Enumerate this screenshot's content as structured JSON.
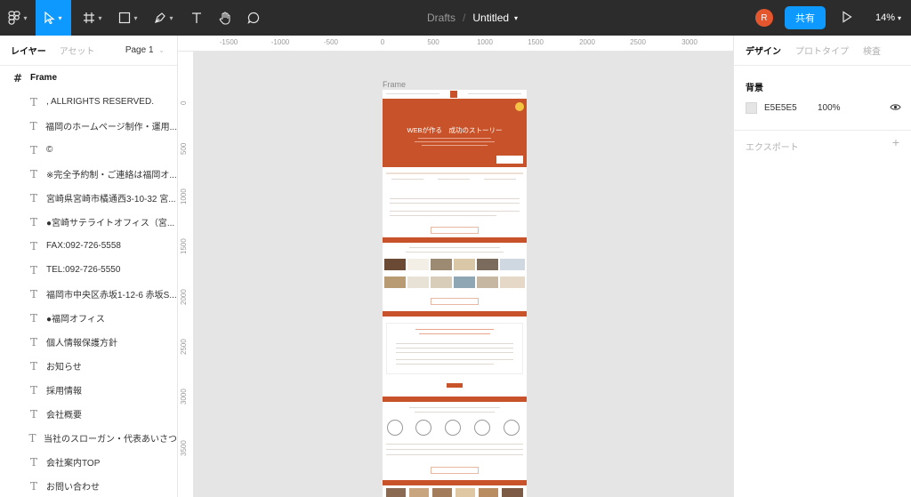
{
  "toolbar": {
    "breadcrumb_project": "Drafts",
    "breadcrumb_separator": "/",
    "file_title": "Untitled",
    "avatar_initial": "R",
    "share_label": "共有",
    "zoom_level": "14%",
    "accent_color": "#0d99ff"
  },
  "left_panel": {
    "tab_layers": "レイヤー",
    "tab_assets": "アセット",
    "page_selector": "Page 1",
    "layers": [
      {
        "label": "Frame",
        "icon": "frame-icon",
        "type": "frame"
      },
      {
        "label": ", ALLRIGHTS RESERVED.",
        "icon": "text-icon"
      },
      {
        "label": "福岡のホームページ制作・運用...",
        "icon": "text-icon"
      },
      {
        "label": "©",
        "icon": "text-icon"
      },
      {
        "label": "※完全予約制・ご連絡は福岡オ...",
        "icon": "text-icon"
      },
      {
        "label": "宮崎県宮崎市橘通西3-10-32 宮...",
        "icon": "text-icon"
      },
      {
        "label": "●宮崎サテライトオフィス（宮...",
        "icon": "text-icon"
      },
      {
        "label": "FAX:092-726-5558",
        "icon": "text-icon"
      },
      {
        "label": "TEL:092-726-5550",
        "icon": "text-icon"
      },
      {
        "label": "福岡市中央区赤坂1-12-6 赤坂S...",
        "icon": "text-icon"
      },
      {
        "label": "●福岡オフィス",
        "icon": "text-icon"
      },
      {
        "label": "個人情報保護方針",
        "icon": "text-icon"
      },
      {
        "label": "お知らせ",
        "icon": "text-icon"
      },
      {
        "label": "採用情報",
        "icon": "text-icon"
      },
      {
        "label": "会社概要",
        "icon": "text-icon"
      },
      {
        "label": "当社のスローガン・代表あいさつ",
        "icon": "text-icon"
      },
      {
        "label": "会社案内TOP",
        "icon": "text-icon"
      },
      {
        "label": "お問い合わせ",
        "icon": "text-icon"
      }
    ]
  },
  "canvas": {
    "ruler_top_ticks": [
      "-1500",
      "-1000",
      "-500",
      "0",
      "500",
      "1000",
      "1500",
      "2000",
      "2500",
      "3000"
    ],
    "ruler_left_ticks": [
      "0",
      "500",
      "1000",
      "1500",
      "2000",
      "2500",
      "3000",
      "3500"
    ],
    "frame_label": "Frame",
    "hero_title": "WEBが作る　成功のストーリー",
    "site_accent_color": "#c8532a"
  },
  "right_panel": {
    "tab_design": "デザイン",
    "tab_prototype": "プロトタイプ",
    "tab_inspect": "検査",
    "background_label": "背景",
    "background_hex": "E5E5E5",
    "background_opacity": "100%",
    "export_label": "エクスポート"
  }
}
